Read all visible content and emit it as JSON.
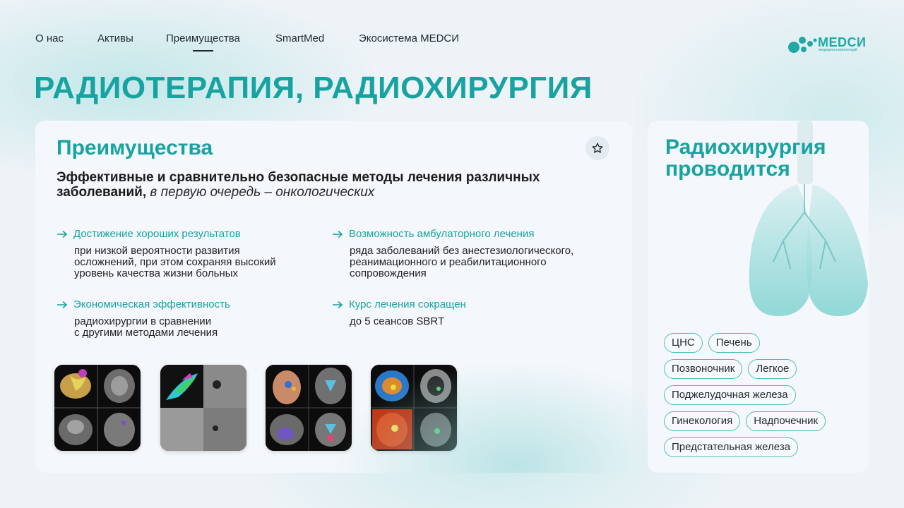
{
  "nav": {
    "items": [
      {
        "label": "О нас"
      },
      {
        "label": "Активы"
      },
      {
        "label": "Преимущества",
        "active": true
      },
      {
        "label": "SmartMed"
      },
      {
        "label": "Экосистема MEDCИ"
      }
    ]
  },
  "logo": {
    "text": "MEDCИ",
    "subtitle": "медицина компетенций"
  },
  "page_title": "РАДИОТЕРАПИЯ, РАДИОХИРУРГИЯ",
  "main": {
    "title": "Преимущества",
    "lead_bold": "Эффективные и сравнительно безопасные методы лечения различных заболеваний,",
    "lead_italic": "в первую очередь – онкологических",
    "features": [
      {
        "title": "Достижение хороших результатов",
        "body": "при низкой вероятности развития\nосложнений, при этом сохраняя высокий\nуровень качества жизни больных"
      },
      {
        "title": "Возможность амбулаторного лечения",
        "body": "ряда заболеваний без анестезиологического,\nреанимационного и реабилитационного\nсопровождения"
      },
      {
        "title": "Экономическая эффективность",
        "body": "радиохирургии в сравнении\nс другими методами лечения"
      },
      {
        "title": "Курс лечения сокращен",
        "body": "до 5 сеансов SBRT"
      }
    ]
  },
  "side": {
    "title": "Радиохирургия проводится",
    "tags": [
      [
        "ЦНС",
        "Печень"
      ],
      [
        "Позвоночник",
        "Легкое"
      ],
      [
        "Поджелудочная железа"
      ],
      [
        "Гинекология",
        "Надпочечник"
      ],
      [
        "Предстательная железа"
      ]
    ]
  },
  "colors": {
    "accent": "#17a3a1",
    "text": "#1c1c1c",
    "card": "#f4f7fb",
    "background": "#eef3f7"
  },
  "icons": {
    "feature": "arrow-right-icon",
    "favorite": "star-icon"
  }
}
